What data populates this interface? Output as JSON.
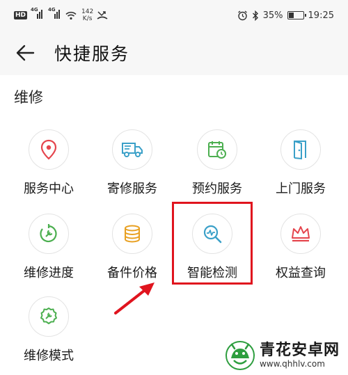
{
  "status_bar": {
    "hd": "HD",
    "signal_1": "4G",
    "signal_2": "4G",
    "speed_value": "142",
    "speed_unit": "K/s",
    "battery": "35%",
    "time": "19:25"
  },
  "header": {
    "title": "快捷服务"
  },
  "section": {
    "title": "维修"
  },
  "items": [
    {
      "label": "服务中心",
      "icon": "location-pin-icon",
      "color": "#e5454d"
    },
    {
      "label": "寄修服务",
      "icon": "truck-icon",
      "color": "#3aa0c8"
    },
    {
      "label": "预约服务",
      "icon": "calendar-clock-icon",
      "color": "#4caf50"
    },
    {
      "label": "上门服务",
      "icon": "door-icon",
      "color": "#3aa0c8"
    },
    {
      "label": "维修进度",
      "icon": "progress-wrench-icon",
      "color": "#4caf50"
    },
    {
      "label": "备件价格",
      "icon": "coins-icon",
      "color": "#e8a021"
    },
    {
      "label": "智能检测",
      "icon": "smart-detect-icon",
      "color": "#3aa0c8"
    },
    {
      "label": "权益查询",
      "icon": "crown-icon",
      "color": "#e5454d"
    },
    {
      "label": "维修模式",
      "icon": "gear-wrench-icon",
      "color": "#4caf50"
    }
  ],
  "annotation": {
    "highlight_color": "#e0141e"
  },
  "watermark": {
    "name": "青花安卓网",
    "url": "www.qhhlv.com"
  }
}
